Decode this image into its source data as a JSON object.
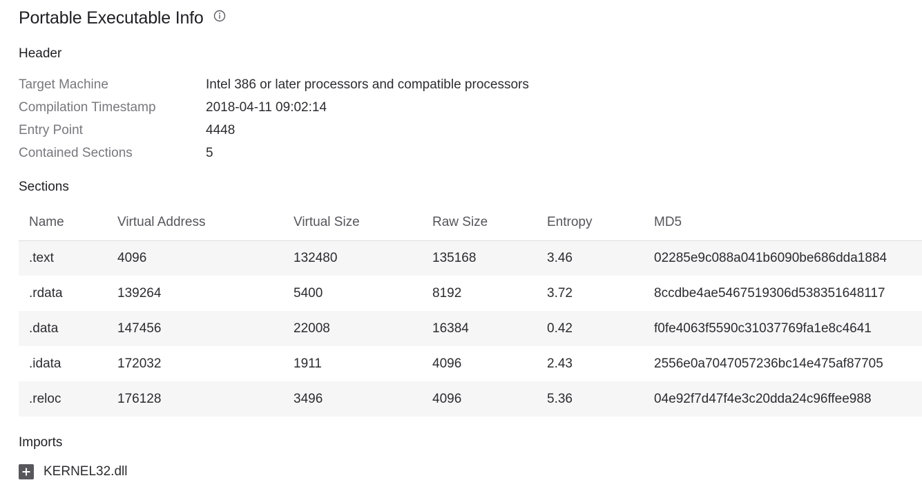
{
  "title": "Portable Executable Info",
  "header": {
    "heading": "Header",
    "rows": [
      {
        "key": "Target Machine",
        "value": "Intel 386 or later processors and compatible processors"
      },
      {
        "key": "Compilation Timestamp",
        "value": "2018-04-11 09:02:14"
      },
      {
        "key": "Entry Point",
        "value": "4448"
      },
      {
        "key": "Contained Sections",
        "value": "5"
      }
    ]
  },
  "sections": {
    "heading": "Sections",
    "columns": [
      "Name",
      "Virtual Address",
      "Virtual Size",
      "Raw Size",
      "Entropy",
      "MD5"
    ],
    "rows": [
      [
        ".text",
        "4096",
        "132480",
        "135168",
        "3.46",
        "02285e9c088a041b6090be686dda1884"
      ],
      [
        ".rdata",
        "139264",
        "5400",
        "8192",
        "3.72",
        "8ccdbe4ae5467519306d538351648117"
      ],
      [
        ".data",
        "147456",
        "22008",
        "16384",
        "0.42",
        "f0fe4063f5590c31037769fa1e8c4641"
      ],
      [
        ".idata",
        "172032",
        "1911",
        "4096",
        "2.43",
        "2556e0a7047057236bc14e475af87705"
      ],
      [
        ".reloc",
        "176128",
        "3496",
        "4096",
        "5.36",
        "04e92f7d47f4e3c20dda24c96ffee988"
      ]
    ]
  },
  "imports": {
    "heading": "Imports",
    "items": [
      {
        "label": "KERNEL32.dll",
        "icon": "plus-square-icon"
      }
    ]
  },
  "icons": {
    "title_info": "info-circle-icon"
  }
}
